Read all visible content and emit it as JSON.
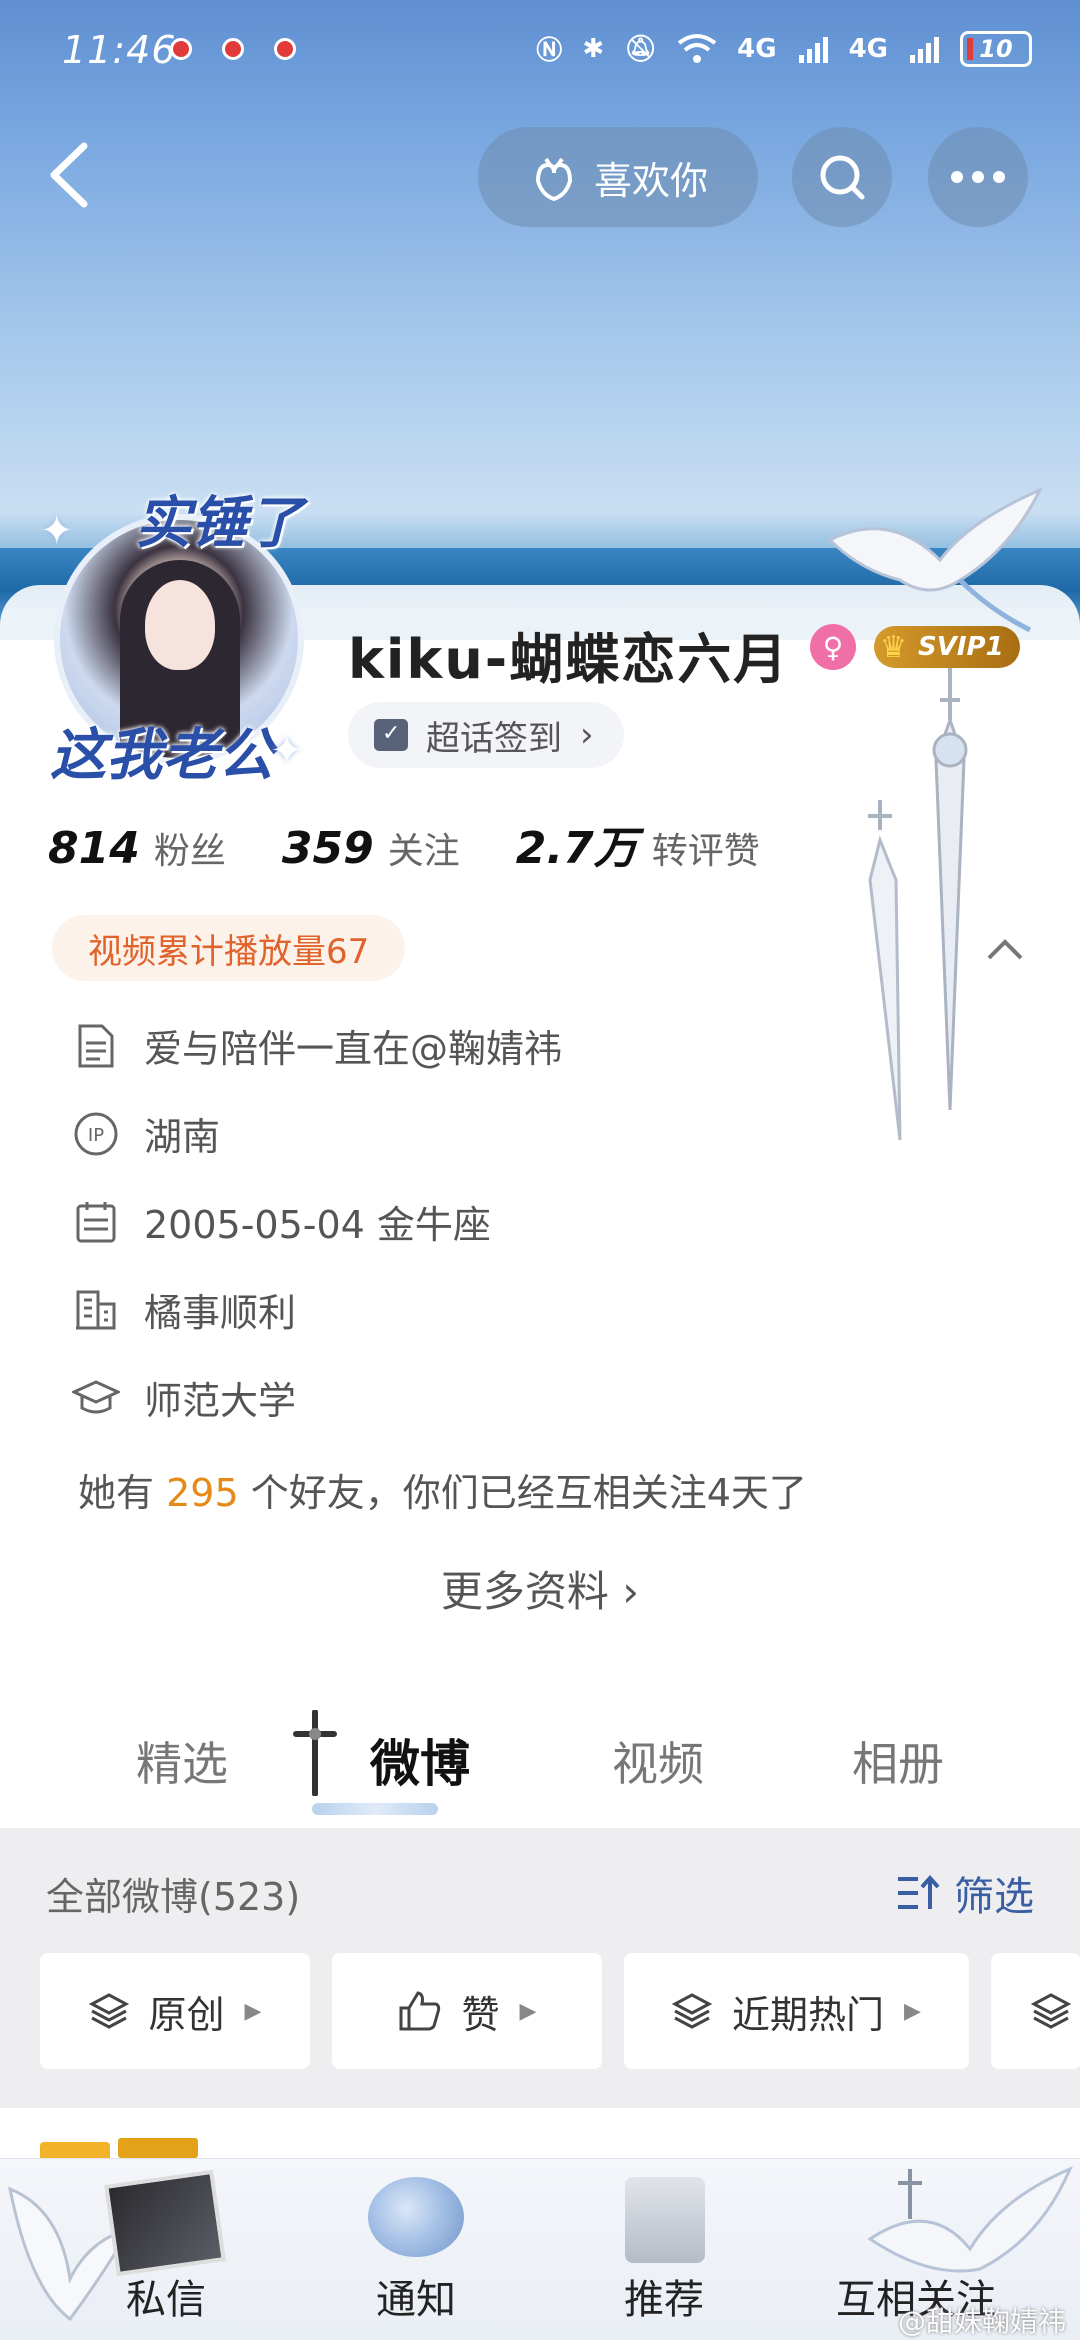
{
  "status_bar": {
    "time": "11:46",
    "network_1": "4G",
    "network_2": "4G",
    "battery": "10"
  },
  "header": {
    "like_button_label": "喜欢你"
  },
  "profile": {
    "avatar_sticker_top": "实锤了",
    "avatar_sticker_bottom": "这我老公",
    "username": "kiku-蝴蝶恋六月",
    "vip_badge": "SVIP1",
    "topic_checkin_label": "超话签到",
    "stats": [
      {
        "value": "814",
        "label": "粉丝"
      },
      {
        "value": "359",
        "label": "关注"
      },
      {
        "value": "2.7万",
        "label": "转评赞"
      }
    ],
    "video_badge": "视频累计播放量67",
    "info": {
      "bio": "爱与陪伴一直在@鞠婧祎",
      "ip": "湖南",
      "birthday": "2005-05-04 金牛座",
      "company": "橘事顺利",
      "school": "师范大学"
    },
    "friends_prefix": "她有",
    "friends_count": "295",
    "friends_suffix": "个好友，你们已经互相关注4天了",
    "more_info": "更多资料"
  },
  "tabs": [
    "精选",
    "微博",
    "视频",
    "相册"
  ],
  "active_tab": "微博",
  "feed": {
    "title": "全部微博(523)",
    "filter_label": "筛选",
    "chips": [
      "原创",
      "赞",
      "近期热门"
    ]
  },
  "bottom_bar": {
    "items": [
      "私信",
      "通知",
      "推荐",
      "互相关注"
    ]
  },
  "watermark": "@甜妹鞠婧祎",
  "colors": {
    "accent_orange": "#e0632b",
    "friends_highlight": "#e58a16",
    "filter_blue": "#3a5ea3",
    "gender_pink": "#f06fa6",
    "svip_gold": "#d49a2b"
  }
}
